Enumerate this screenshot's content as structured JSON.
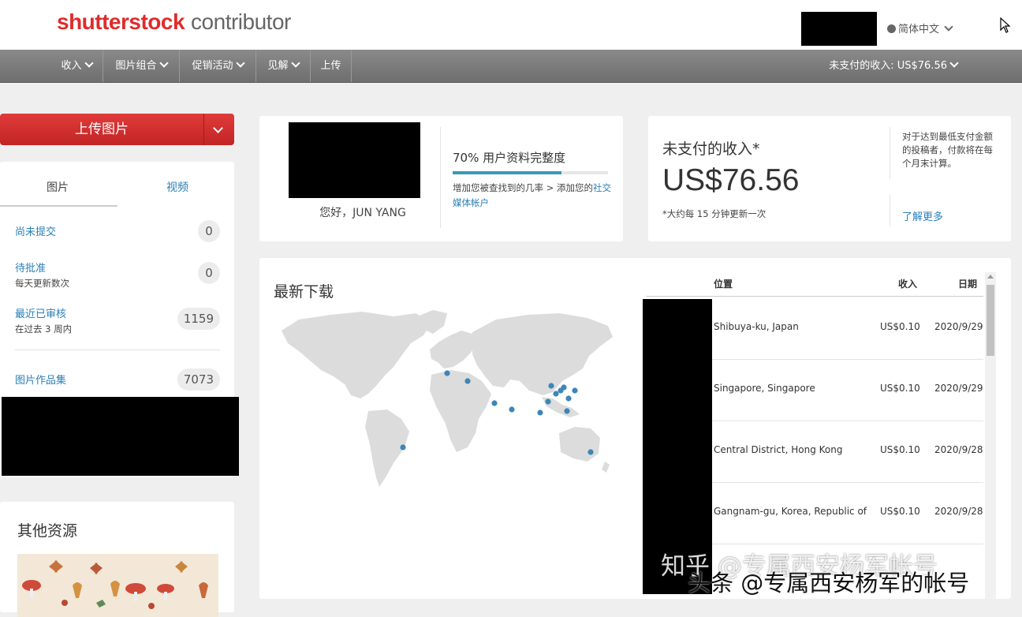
{
  "header": {
    "logo_brand": "shutterstock",
    "logo_sub": "contributor",
    "language": "简体中文"
  },
  "nav": {
    "items": [
      "收入",
      "图片组合",
      "促销活动",
      "见解",
      "上传"
    ],
    "unpaid": "未支付的收入: US$76.56"
  },
  "sidebar": {
    "upload_label": "上传图片",
    "tabs": [
      "图片",
      "视频"
    ],
    "rows": [
      {
        "label": "尚未提交",
        "sub": "",
        "count": "0"
      },
      {
        "label": "待批准",
        "sub": "每天更新数次",
        "count": "0"
      },
      {
        "label": "最近已审核",
        "sub": "在过去 3 周内",
        "count": "1159"
      },
      {
        "label": "图片作品集",
        "sub": "",
        "count": "7073"
      }
    ]
  },
  "resources": {
    "title": "其他资源"
  },
  "profile": {
    "greeting": "您好，JUN YANG",
    "completeness_title": "70% 用户资料完整度",
    "completeness_pct": 70,
    "desc_text": "增加您被查找到的几率 > 添加您的",
    "desc_link": "社交媒体帐户"
  },
  "earnings": {
    "title": "未支付的收入*",
    "amount": "US$76.56",
    "note": "*大约每 15 分钟更新一次",
    "side_note": "对于达到最低支付金额的投稿者，付款将在每个月末计算。",
    "learn_more": "了解更多"
  },
  "downloads": {
    "title": "最新下载",
    "columns": [
      "位置",
      "收入",
      "日期"
    ],
    "rows": [
      {
        "location": "Shibuya-ku, Japan",
        "earning": "US$0.10",
        "date": "2020/9/29"
      },
      {
        "location": "Singapore, Singapore",
        "earning": "US$0.10",
        "date": "2020/9/29"
      },
      {
        "location": "Central District, Hong Kong",
        "earning": "US$0.10",
        "date": "2020/9/28"
      },
      {
        "location": "Gangnam-gu, Korea, Republic of",
        "earning": "US$0.10",
        "date": "2020/9/28"
      }
    ],
    "marker_color": "#3d86b8"
  },
  "watermark": {
    "line1": "知乎 @专属西安杨军帐号",
    "line2": "头条 @专属西安杨军的帐号"
  }
}
